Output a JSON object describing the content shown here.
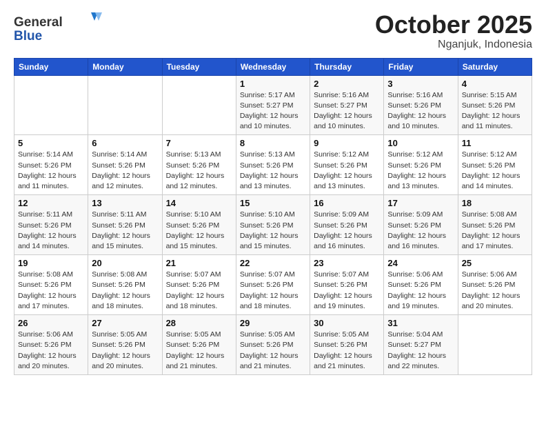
{
  "header": {
    "logo_general": "General",
    "logo_blue": "Blue",
    "month_title": "October 2025",
    "subtitle": "Nganjuk, Indonesia"
  },
  "days_of_week": [
    "Sunday",
    "Monday",
    "Tuesday",
    "Wednesday",
    "Thursday",
    "Friday",
    "Saturday"
  ],
  "weeks": [
    [
      {
        "day": "",
        "info": ""
      },
      {
        "day": "",
        "info": ""
      },
      {
        "day": "",
        "info": ""
      },
      {
        "day": "1",
        "info": "Sunrise: 5:17 AM\nSunset: 5:27 PM\nDaylight: 12 hours\nand 10 minutes."
      },
      {
        "day": "2",
        "info": "Sunrise: 5:16 AM\nSunset: 5:27 PM\nDaylight: 12 hours\nand 10 minutes."
      },
      {
        "day": "3",
        "info": "Sunrise: 5:16 AM\nSunset: 5:26 PM\nDaylight: 12 hours\nand 10 minutes."
      },
      {
        "day": "4",
        "info": "Sunrise: 5:15 AM\nSunset: 5:26 PM\nDaylight: 12 hours\nand 11 minutes."
      }
    ],
    [
      {
        "day": "5",
        "info": "Sunrise: 5:14 AM\nSunset: 5:26 PM\nDaylight: 12 hours\nand 11 minutes."
      },
      {
        "day": "6",
        "info": "Sunrise: 5:14 AM\nSunset: 5:26 PM\nDaylight: 12 hours\nand 12 minutes."
      },
      {
        "day": "7",
        "info": "Sunrise: 5:13 AM\nSunset: 5:26 PM\nDaylight: 12 hours\nand 12 minutes."
      },
      {
        "day": "8",
        "info": "Sunrise: 5:13 AM\nSunset: 5:26 PM\nDaylight: 12 hours\nand 13 minutes."
      },
      {
        "day": "9",
        "info": "Sunrise: 5:12 AM\nSunset: 5:26 PM\nDaylight: 12 hours\nand 13 minutes."
      },
      {
        "day": "10",
        "info": "Sunrise: 5:12 AM\nSunset: 5:26 PM\nDaylight: 12 hours\nand 13 minutes."
      },
      {
        "day": "11",
        "info": "Sunrise: 5:12 AM\nSunset: 5:26 PM\nDaylight: 12 hours\nand 14 minutes."
      }
    ],
    [
      {
        "day": "12",
        "info": "Sunrise: 5:11 AM\nSunset: 5:26 PM\nDaylight: 12 hours\nand 14 minutes."
      },
      {
        "day": "13",
        "info": "Sunrise: 5:11 AM\nSunset: 5:26 PM\nDaylight: 12 hours\nand 15 minutes."
      },
      {
        "day": "14",
        "info": "Sunrise: 5:10 AM\nSunset: 5:26 PM\nDaylight: 12 hours\nand 15 minutes."
      },
      {
        "day": "15",
        "info": "Sunrise: 5:10 AM\nSunset: 5:26 PM\nDaylight: 12 hours\nand 15 minutes."
      },
      {
        "day": "16",
        "info": "Sunrise: 5:09 AM\nSunset: 5:26 PM\nDaylight: 12 hours\nand 16 minutes."
      },
      {
        "day": "17",
        "info": "Sunrise: 5:09 AM\nSunset: 5:26 PM\nDaylight: 12 hours\nand 16 minutes."
      },
      {
        "day": "18",
        "info": "Sunrise: 5:08 AM\nSunset: 5:26 PM\nDaylight: 12 hours\nand 17 minutes."
      }
    ],
    [
      {
        "day": "19",
        "info": "Sunrise: 5:08 AM\nSunset: 5:26 PM\nDaylight: 12 hours\nand 17 minutes."
      },
      {
        "day": "20",
        "info": "Sunrise: 5:08 AM\nSunset: 5:26 PM\nDaylight: 12 hours\nand 18 minutes."
      },
      {
        "day": "21",
        "info": "Sunrise: 5:07 AM\nSunset: 5:26 PM\nDaylight: 12 hours\nand 18 minutes."
      },
      {
        "day": "22",
        "info": "Sunrise: 5:07 AM\nSunset: 5:26 PM\nDaylight: 12 hours\nand 18 minutes."
      },
      {
        "day": "23",
        "info": "Sunrise: 5:07 AM\nSunset: 5:26 PM\nDaylight: 12 hours\nand 19 minutes."
      },
      {
        "day": "24",
        "info": "Sunrise: 5:06 AM\nSunset: 5:26 PM\nDaylight: 12 hours\nand 19 minutes."
      },
      {
        "day": "25",
        "info": "Sunrise: 5:06 AM\nSunset: 5:26 PM\nDaylight: 12 hours\nand 20 minutes."
      }
    ],
    [
      {
        "day": "26",
        "info": "Sunrise: 5:06 AM\nSunset: 5:26 PM\nDaylight: 12 hours\nand 20 minutes."
      },
      {
        "day": "27",
        "info": "Sunrise: 5:05 AM\nSunset: 5:26 PM\nDaylight: 12 hours\nand 20 minutes."
      },
      {
        "day": "28",
        "info": "Sunrise: 5:05 AM\nSunset: 5:26 PM\nDaylight: 12 hours\nand 21 minutes."
      },
      {
        "day": "29",
        "info": "Sunrise: 5:05 AM\nSunset: 5:26 PM\nDaylight: 12 hours\nand 21 minutes."
      },
      {
        "day": "30",
        "info": "Sunrise: 5:05 AM\nSunset: 5:26 PM\nDaylight: 12 hours\nand 21 minutes."
      },
      {
        "day": "31",
        "info": "Sunrise: 5:04 AM\nSunset: 5:27 PM\nDaylight: 12 hours\nand 22 minutes."
      },
      {
        "day": "",
        "info": ""
      }
    ]
  ]
}
